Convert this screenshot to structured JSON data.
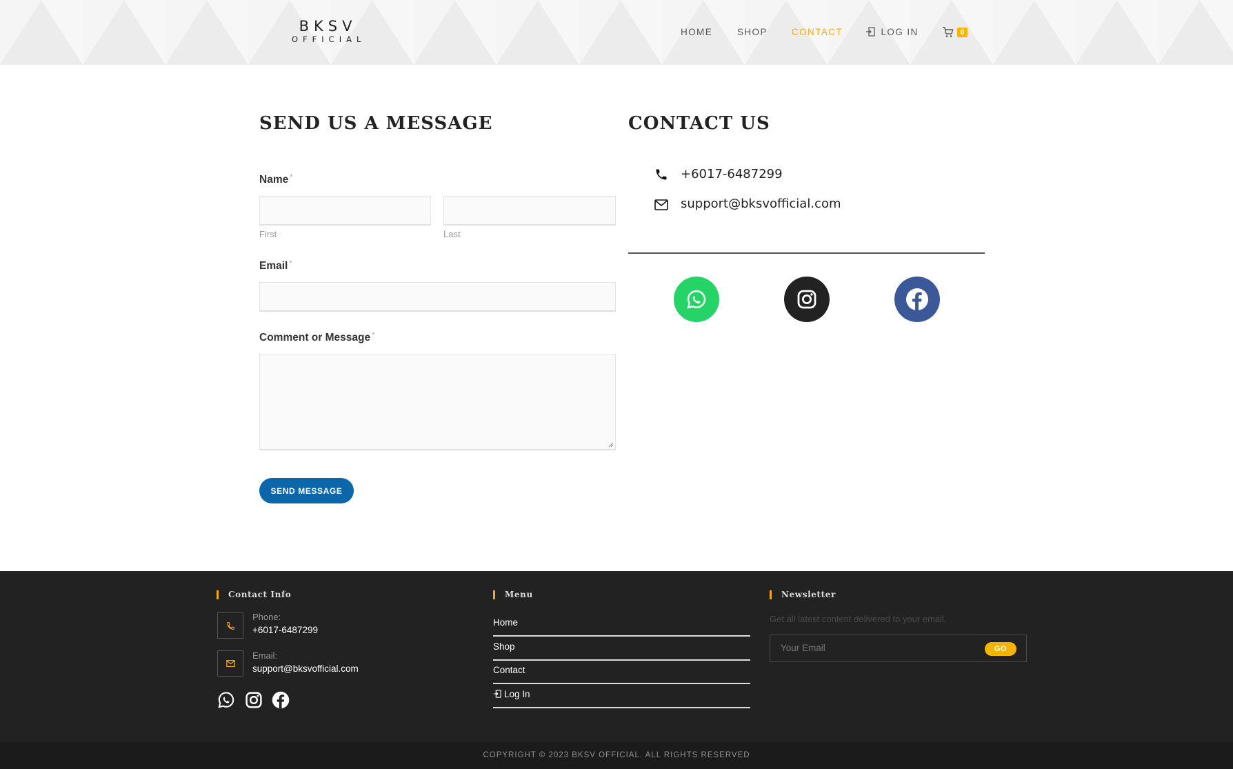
{
  "header": {
    "logo_line1": "BKSV",
    "logo_line2": "OFFICIAL",
    "nav": {
      "home": "HOME",
      "shop": "SHOP",
      "contact": "CONTACT",
      "login": "LOG IN"
    },
    "cart_count": "0",
    "active_color": "#f5a623"
  },
  "form": {
    "title": "SEND US A MESSAGE",
    "name_label": "Name",
    "required_mark": "*",
    "first_sub": "First",
    "last_sub": "Last",
    "email_label": "Email",
    "comment_label": "Comment or Message",
    "submit_label": "SEND MESSAGE",
    "submit_color": "#0b67a9"
  },
  "contact": {
    "title": "CONTACT US",
    "phone": "+6017-6487299",
    "email": "support@bksvofficial.com",
    "socials": [
      {
        "name": "whatsapp",
        "color": "#25d366"
      },
      {
        "name": "instagram",
        "color": "#222222"
      },
      {
        "name": "facebook",
        "color": "#3b5998"
      }
    ]
  },
  "footer": {
    "contact_info_title": "Contact Info",
    "phone_label": "Phone:",
    "phone_value": "+6017-6487299",
    "email_label": "Email:",
    "email_value": "support@bksvofficial.com",
    "menu_title": "Menu",
    "menu_items": [
      "Home",
      "Shop",
      "Contact",
      "Log In"
    ],
    "newsletter_title": "Newsletter",
    "newsletter_text": "Get all latest content delivered to your email.",
    "newsletter_placeholder": "Your Email",
    "newsletter_button": "GO",
    "copyright": "COPYRIGHT © 2023 BKSV OFFICIAL. ALL RIGHTS RESERVED"
  }
}
